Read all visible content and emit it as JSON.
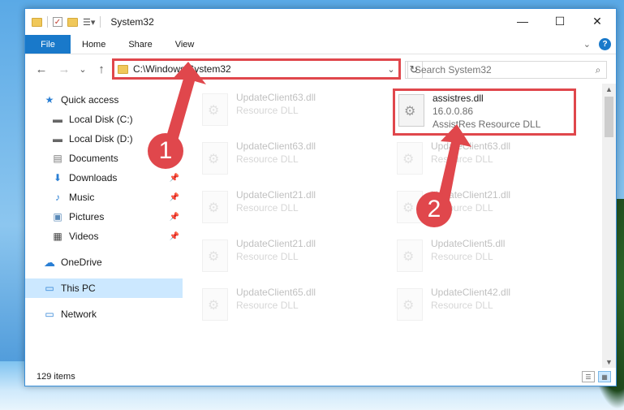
{
  "window": {
    "title": "System32"
  },
  "ribbon": {
    "file": "File",
    "tabs": [
      "Home",
      "Share",
      "View"
    ],
    "help": "?"
  },
  "nav": {
    "back": "←",
    "forward": "→",
    "recent": "⌄",
    "up": "↑"
  },
  "address": {
    "path": "C:\\Windows\\System32",
    "dropdown": "⌄",
    "refresh": "↻"
  },
  "search": {
    "placeholder": "Search System32"
  },
  "sidebar": {
    "items": [
      {
        "label": "Quick access",
        "icon": "★"
      },
      {
        "label": "Local Disk (C:)",
        "icon": "▬"
      },
      {
        "label": "Local Disk (D:)",
        "icon": "▬"
      },
      {
        "label": "Documents",
        "icon": "▤"
      },
      {
        "label": "Downloads",
        "icon": "⬇"
      },
      {
        "label": "Music",
        "icon": "♪"
      },
      {
        "label": "Pictures",
        "icon": "▣"
      },
      {
        "label": "Videos",
        "icon": "▦"
      },
      {
        "label": "OneDrive",
        "icon": "☁"
      },
      {
        "label": "This PC",
        "icon": "▭"
      },
      {
        "label": "Network",
        "icon": "▭"
      }
    ],
    "pin": "📌"
  },
  "files": [
    {
      "name": "UpdateClient63.dll",
      "type": "Resource DLL"
    },
    {
      "name": "assistres.dll",
      "version": "16.0.0.86",
      "description": "AssistRes Resource DLL"
    },
    {
      "name": "UpdateClient63.dll",
      "type": "Resource DLL"
    },
    {
      "name": "UpdateClient63.dll",
      "type": "Resource DLL"
    },
    {
      "name": "UpdateClient21.dll",
      "type": "Resource DLL"
    },
    {
      "name": "UpdateClient21.dll",
      "type": "Resource DLL"
    },
    {
      "name": "UpdateClient21.dll",
      "type": "Resource DLL"
    },
    {
      "name": "UpdateClient5.dll",
      "type": "Resource DLL"
    },
    {
      "name": "UpdateClient65.dll",
      "type": "Resource DLL"
    },
    {
      "name": "UpdateClient42.dll",
      "type": "Resource DLL"
    }
  ],
  "status": {
    "items": "129 items"
  },
  "callouts": [
    "1",
    "2"
  ],
  "colors": {
    "accent": "#1979ca",
    "highlight": "#e0474c",
    "selected": "#cce8ff"
  }
}
